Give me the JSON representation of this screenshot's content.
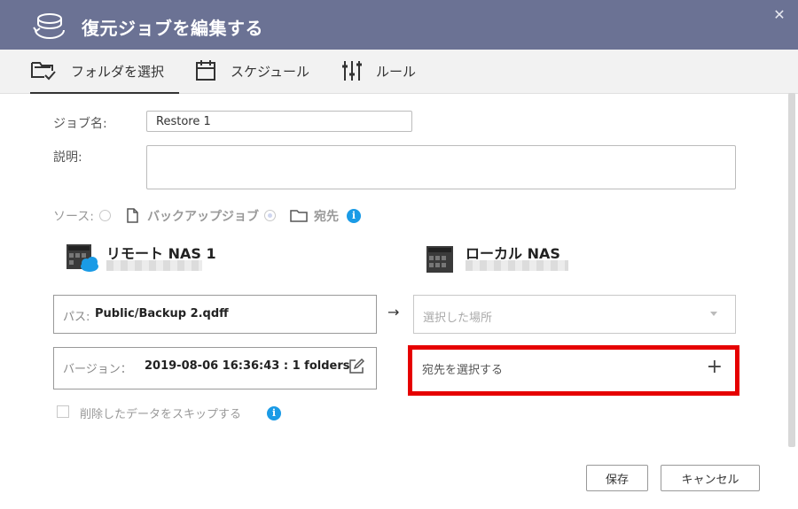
{
  "window": {
    "title": "復元ジョブを編集する",
    "close_symbol": "✕"
  },
  "tabs": [
    {
      "label": "フォルダを選択",
      "icon": "folder-check-icon",
      "active": true
    },
    {
      "label": "スケジュール",
      "icon": "calendar-icon",
      "active": false
    },
    {
      "label": "ルール",
      "icon": "sliders-icon",
      "active": false
    }
  ],
  "form": {
    "job_name_label": "ジョブ名:",
    "job_name_value": "Restore 1",
    "description_label": "説明:",
    "description_value": "",
    "source_label": "ソース:",
    "source_options": [
      {
        "label": "バックアップジョブ",
        "icon": "file-icon",
        "selected": false
      },
      {
        "label": "宛先",
        "icon": "folder-icon",
        "selected": true
      }
    ],
    "info_symbol": "i"
  },
  "source_nas": {
    "title": "リモート NAS 1",
    "path_label": "パス:",
    "path_value": "Public/Backup 2.qdff",
    "version_label": "バージョン：",
    "version_value": "2019-08-06 16:36:43 : 1 folders"
  },
  "arrow_symbol": "→",
  "dest_nas": {
    "title": "ローカル NAS",
    "location_placeholder": "選択した場所",
    "select_destination_label": "宛先を選択する",
    "plus_symbol": "+"
  },
  "skip_deleted_label": "削除したデータをスキップする",
  "buttons": {
    "save": "保存",
    "cancel": "キャンセル"
  },
  "colors": {
    "title_bar": "#6b7294",
    "highlight": "#e60000",
    "info": "#1a9be6"
  }
}
